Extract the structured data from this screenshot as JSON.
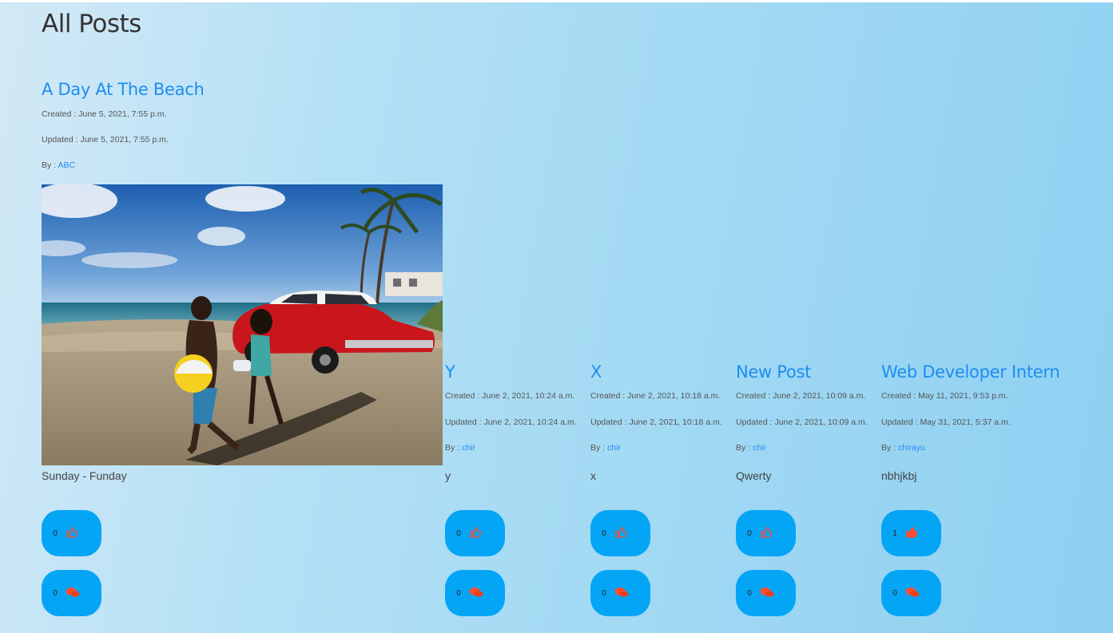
{
  "page": {
    "title": "All Posts"
  },
  "posts": [
    {
      "title": "A Day At The Beach",
      "created": "Created : June 5, 2021, 7:55 p.m.",
      "updated": "Updated : June 5, 2021, 7:55 p.m.",
      "by_label": "By : ",
      "author": "ABC",
      "body": "Sunday - Funday",
      "likes": "0",
      "comments": "0"
    },
    {
      "title": "Y",
      "created": "Created : June 2, 2021, 10:24 a.m.",
      "updated": "Updated : June 2, 2021, 10:24 a.m.",
      "by_label": "By : ",
      "author": "chir",
      "body": "y",
      "likes": "0",
      "comments": "0"
    },
    {
      "title": "X",
      "created": "Created : June 2, 2021, 10:18 a.m.",
      "updated": "Updated : June 2, 2021, 10:18 a.m.",
      "by_label": "By : ",
      "author": "chir",
      "body": "x",
      "likes": "0",
      "comments": "0"
    },
    {
      "title": "New Post",
      "created": "Created : June 2, 2021, 10:09 a.m.",
      "updated": "Updated : June 2, 2021, 10:09 a.m.",
      "by_label": "By : ",
      "author": "chir",
      "body": "Qwerty",
      "likes": "0",
      "comments": "0"
    },
    {
      "title": "Web Developer Intern",
      "created": "Created : May 11, 2021, 9:53 p.m.",
      "updated": "Updated : May 31, 2021, 5:37 a.m.",
      "by_label": "By : ",
      "author": "chirayu",
      "body": "nbhjkbj",
      "likes": "1",
      "comments": "0"
    }
  ],
  "icons": {
    "like": "thumbs-up-icon",
    "comment": "comment-bubbles-icon"
  },
  "colors": {
    "link": "#1e8cf0",
    "button": "#05a5f6",
    "icon": "#ff4d2e"
  }
}
